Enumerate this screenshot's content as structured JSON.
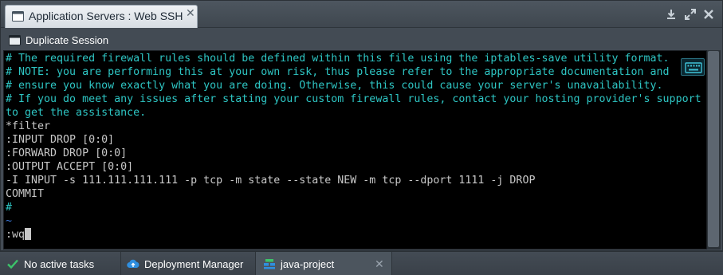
{
  "window": {
    "tab_title": "Application Servers : Web SSH",
    "tab_close": "✕",
    "icons": [
      "window-icon",
      "download-icon",
      "expand-icon",
      "close-icon"
    ]
  },
  "toolbar": {
    "duplicate_label": "Duplicate Session"
  },
  "terminal": {
    "lines": [
      {
        "text": "# The required firewall rules should be defined within this file using the iptables-save utility format.",
        "style": "comment"
      },
      {
        "text": "# NOTE: you are performing this at your own risk, thus please refer to the appropriate documentation and",
        "style": "comment"
      },
      {
        "text": "# ensure you know exactly what you are doing. Otherwise, this could cause your server's unavailability.",
        "style": "comment"
      },
      {
        "text": "# If you do meet any issues after stating your custom firewall rules, contact your hosting provider's support",
        "style": "comment"
      },
      {
        "text": "to get the assistance.",
        "style": "comment"
      },
      {
        "text": "*filter",
        "style": "plain"
      },
      {
        "text": ":INPUT DROP [0:0]",
        "style": "plain"
      },
      {
        "text": ":FORWARD DROP [0:0]",
        "style": "plain"
      },
      {
        "text": ":OUTPUT ACCEPT [0:0]",
        "style": "plain"
      },
      {
        "text": "-I INPUT -s 111.111.111.111 -p tcp -m state --state NEW -m tcp --dport 1111 -j DROP",
        "style": "plain"
      },
      {
        "text": "COMMIT",
        "style": "plain"
      },
      {
        "text": "#",
        "style": "hash"
      },
      {
        "text": "~",
        "style": "tilde"
      }
    ],
    "command": ":wq"
  },
  "taskbar": {
    "tasks_label": "No active tasks",
    "deployment_label": "Deployment Manager",
    "project_label": "java-project",
    "project_close": "✕"
  },
  "colors": {
    "comment": "#2ec6c4",
    "plain": "#c8c8c8",
    "tilde": "#3a78d8",
    "check": "#3cc46a",
    "cloud": "#2f8fe0"
  }
}
